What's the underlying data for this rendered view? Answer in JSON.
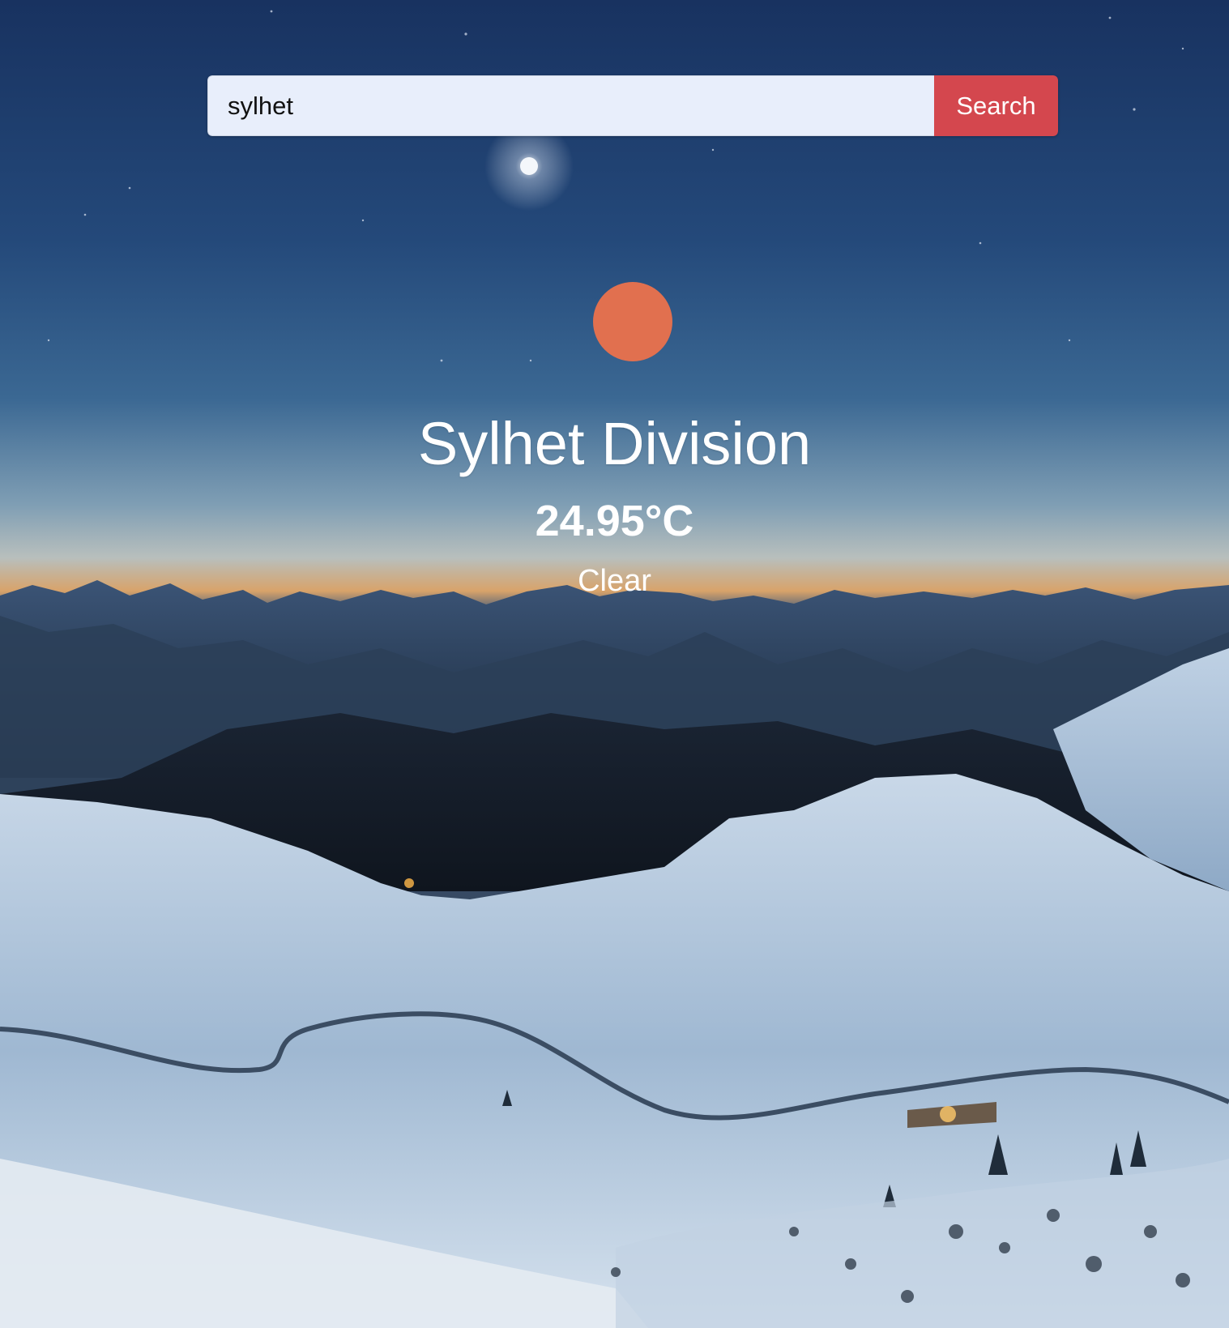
{
  "search": {
    "value": "sylhet",
    "button_label": "Search"
  },
  "weather": {
    "icon": "sun-circle-icon",
    "city": "Sylhet Division",
    "temperature": "24.95°C",
    "condition": "Clear"
  },
  "colors": {
    "search_button": "#d4474e",
    "input_background": "#e8eefb",
    "weather_icon": "#e1704f",
    "text": "#ffffff"
  }
}
